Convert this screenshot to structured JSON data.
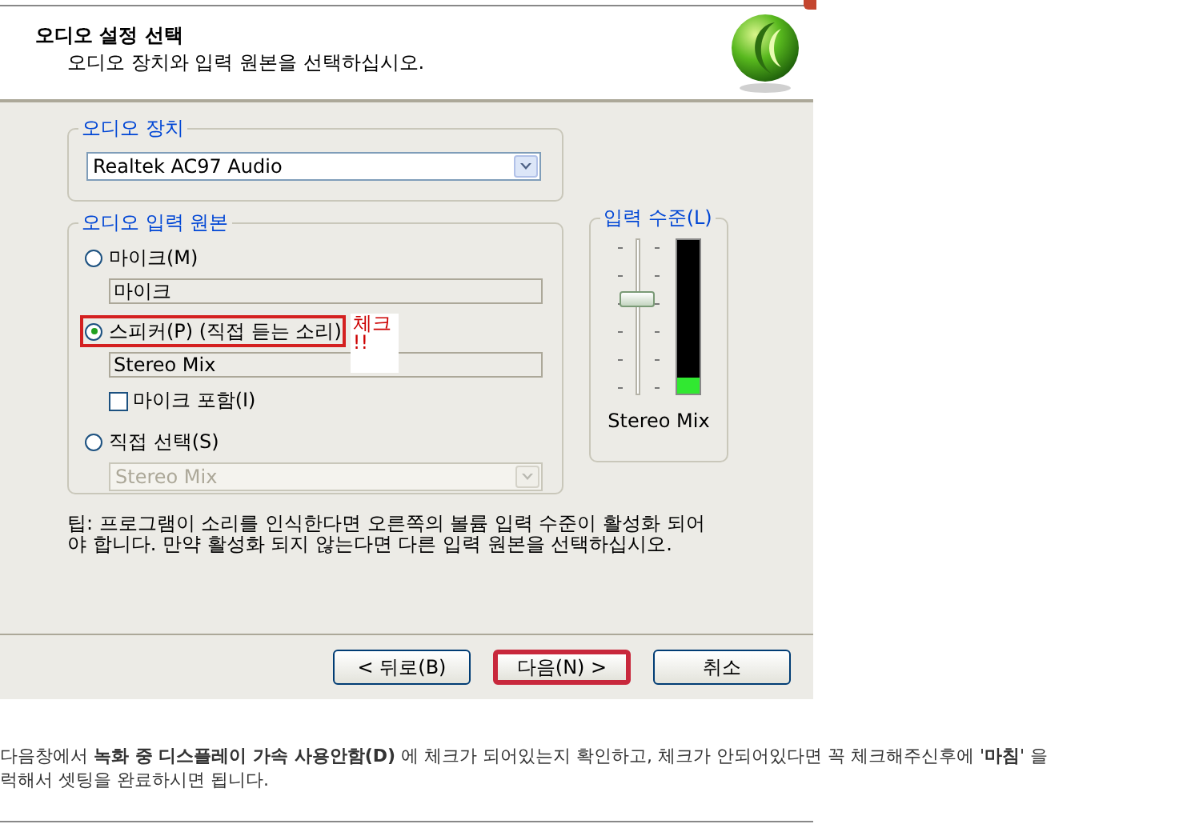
{
  "dialog": {
    "title": "오디오 설정 선택",
    "subtitle": "오디오 장치와 입력 원본을 선택하십시오."
  },
  "device_group": {
    "label": "오디오 장치",
    "value": "Realtek AC97 Audio"
  },
  "source_group": {
    "label": "오디오 입력 원본",
    "options": [
      {
        "label": "마이크(M)",
        "selected": false,
        "highlighted": false,
        "field": {
          "kind": "text",
          "value": "마이크"
        }
      },
      {
        "label": "스피커(P) (직접 듣는 소리)",
        "selected": true,
        "highlighted": true,
        "field": {
          "kind": "text",
          "value": "Stereo Mix"
        },
        "checkbox": {
          "label": "마이크 포함(I)",
          "checked": false
        }
      },
      {
        "label": "직접 선택(S)",
        "selected": false,
        "highlighted": false,
        "field": {
          "kind": "dropdown",
          "value": "Stereo Mix",
          "disabled": true
        }
      }
    ]
  },
  "annotation": {
    "text": "체크",
    "mark": "!!"
  },
  "level_group": {
    "label": "입력 수준(L)",
    "slider": {
      "level": 0.63
    },
    "meter": {
      "level": 0.1
    },
    "caption": "Stereo Mix"
  },
  "tip": "팁: 프로그램이 소리를 인식한다면 오른쪽의 볼륨 입력 수준이 활성화 되어 야 합니다.  만약 활성화 되지 않는다면 다른 입력 원본을 선택하십시오.",
  "buttons": [
    {
      "label": "< 뒤로(B)",
      "highlighted": false
    },
    {
      "label": "다음(N) >",
      "highlighted": true
    },
    {
      "label": "취소",
      "highlighted": false
    }
  ],
  "article": {
    "lines": [
      "다음창에서 **녹화 중 디스플레이 가속 사용안함(D)** 에 체크가 되어있는지 확인하고, 체크가 안되어있다면 꼭 체크해주신후에 '**마침**' 을",
      "럭해서 셋팅을 완료하시면 됩니다."
    ]
  }
}
